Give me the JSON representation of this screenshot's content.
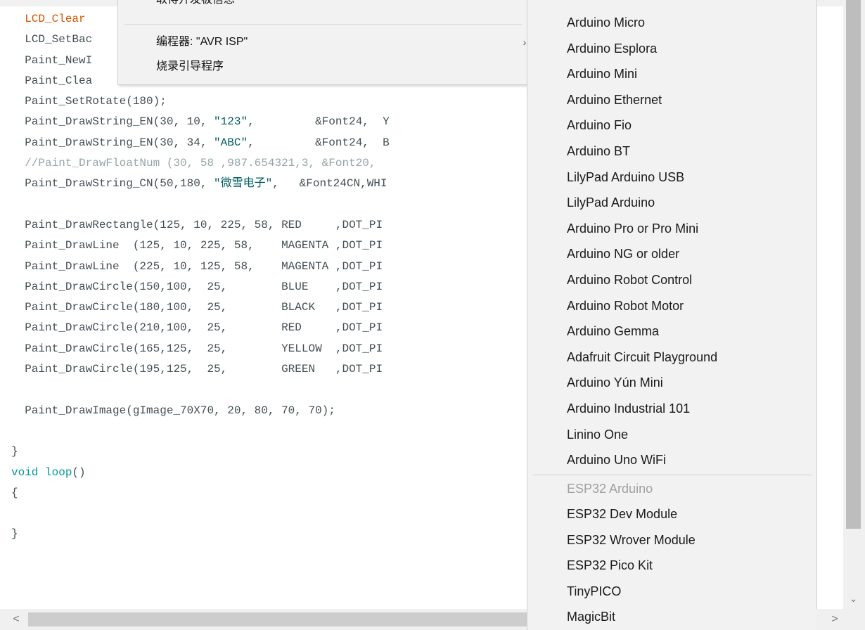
{
  "editor": {
    "lines": [
      [
        {
          "t": "  "
        },
        {
          "t": "LCD_Clear",
          "c": "fn"
        }
      ],
      [
        {
          "t": "  LCD_SetBac"
        }
      ],
      [
        {
          "t": "  Paint_NewI"
        }
      ],
      [
        {
          "t": "  Paint_Clea"
        }
      ],
      [
        {
          "t": "  Paint_SetRotate(180);"
        }
      ],
      [
        {
          "t": "  Paint_DrawString_EN(30, 10, "
        },
        {
          "t": "\"123\"",
          "c": "str"
        },
        {
          "t": ",         &Font24,  Y"
        }
      ],
      [
        {
          "t": "  Paint_DrawString_EN(30, 34, "
        },
        {
          "t": "\"ABC\"",
          "c": "str"
        },
        {
          "t": ",         &Font24,  B"
        }
      ],
      [
        {
          "t": "  //Paint_DrawFloatNum (30, 58 ,987.654321,3, &Font20,",
          "c": "cmt"
        }
      ],
      [
        {
          "t": "  Paint_DrawString_CN(50,180, "
        },
        {
          "t": "\"微雪电子\"",
          "c": "str"
        },
        {
          "t": ",   &Font24CN,WHI"
        }
      ],
      [
        {
          "t": ""
        }
      ],
      [
        {
          "t": "  Paint_DrawRectangle(125, 10, 225, 58, RED     ,DOT_PI"
        }
      ],
      [
        {
          "t": "  Paint_DrawLine  (125, 10, 225, 58,    MAGENTA ,DOT_PI"
        }
      ],
      [
        {
          "t": "  Paint_DrawLine  (225, 10, 125, 58,    MAGENTA ,DOT_PI"
        }
      ],
      [
        {
          "t": "  Paint_DrawCircle(150,100,  25,        BLUE    ,DOT_PI"
        }
      ],
      [
        {
          "t": "  Paint_DrawCircle(180,100,  25,        BLACK   ,DOT_PI"
        }
      ],
      [
        {
          "t": "  Paint_DrawCircle(210,100,  25,        RED     ,DOT_PI"
        }
      ],
      [
        {
          "t": "  Paint_DrawCircle(165,125,  25,        YELLOW  ,DOT_PI"
        }
      ],
      [
        {
          "t": "  Paint_DrawCircle(195,125,  25,        GREEN   ,DOT_PI"
        }
      ],
      [
        {
          "t": ""
        }
      ],
      [
        {
          "t": "  Paint_DrawImage(gImage_70X70, 20, 80, 70, 70);"
        }
      ],
      [
        {
          "t": ""
        }
      ],
      [
        {
          "t": "}"
        }
      ],
      [
        {
          "t": "void",
          "c": "kw"
        },
        {
          "t": " "
        },
        {
          "t": "loop",
          "c": "kw"
        },
        {
          "t": "()"
        }
      ],
      [
        {
          "t": "{"
        }
      ],
      [
        {
          "t": ""
        }
      ],
      [
        {
          "t": "}"
        }
      ]
    ]
  },
  "menu_primary": {
    "partial_item": "取得开发板信息",
    "programmer_label": "编程器: \"AVR ISP\"",
    "burn_bootloader_label": "烧录引导程序",
    "arrow": "›"
  },
  "board_menu": {
    "items": [
      "Arduino Micro",
      "Arduino Esplora",
      "Arduino Mini",
      "Arduino Ethernet",
      "Arduino Fio",
      "Arduino BT",
      "LilyPad Arduino USB",
      "LilyPad Arduino",
      "Arduino Pro or Pro Mini",
      "Arduino NG or older",
      "Arduino Robot Control",
      "Arduino Robot Motor",
      "Arduino Gemma",
      "Adafruit Circuit Playground",
      "Arduino Yún Mini",
      "Arduino Industrial 101",
      "Linino One",
      "Arduino Uno WiFi"
    ],
    "section_header": "ESP32 Arduino",
    "esp32_items": [
      "ESP32 Dev Module",
      "ESP32 Wrover Module",
      "ESP32 Pico Kit",
      "TinyPICO",
      "MagicBit"
    ]
  },
  "scrollbars": {
    "left_arrow": "<",
    "right_arrow": ">",
    "down_arrow": "⌄"
  }
}
